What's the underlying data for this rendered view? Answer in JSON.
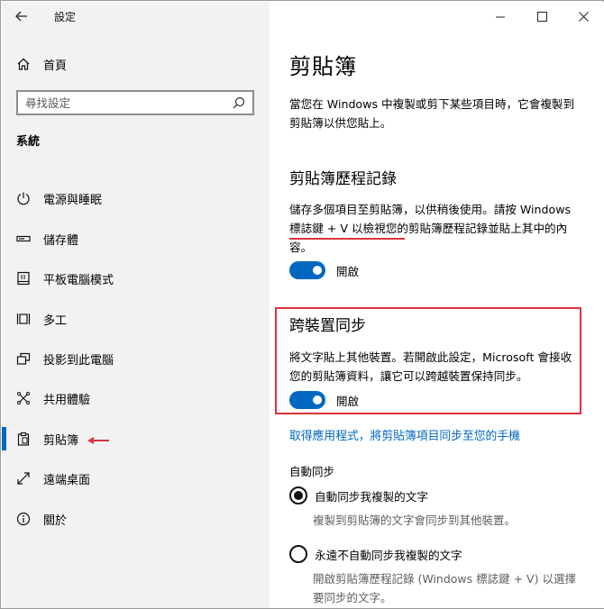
{
  "app": {
    "title": "設定"
  },
  "sidebar": {
    "home_label": "首頁",
    "search_placeholder": "尋找設定",
    "section": "系統",
    "items": [
      {
        "label": "電源與睡眠",
        "icon": "power-icon"
      },
      {
        "label": "儲存體",
        "icon": "storage-icon"
      },
      {
        "label": "平板電腦模式",
        "icon": "tablet-icon"
      },
      {
        "label": "多工",
        "icon": "multitasking-icon"
      },
      {
        "label": "投影到此電腦",
        "icon": "projecting-icon"
      },
      {
        "label": "共用體驗",
        "icon": "shared-experiences-icon"
      },
      {
        "label": "剪貼簿",
        "icon": "clipboard-icon",
        "active": true
      },
      {
        "label": "遠端桌面",
        "icon": "remote-desktop-icon"
      },
      {
        "label": "關於",
        "icon": "info-icon"
      }
    ]
  },
  "main": {
    "title": "剪貼簿",
    "intro": "當您在 Windows 中複製或剪下某些項目時，它會複製到剪貼簿以供您貼上。",
    "history": {
      "heading": "剪貼簿歷程記錄",
      "desc": "儲存多個項目至剪貼簿，以供稍後使用。請按 Windows 標誌鍵 + V 以檢視您的剪貼簿歷程記錄並貼上其中的內容。",
      "toggle_label": "開啟"
    },
    "sync": {
      "heading": "跨裝置同步",
      "desc": "將文字貼上其他裝置。若開啟此設定，Microsoft 會接收您的剪貼簿資料，讓它可以跨越裝置保持同步。",
      "toggle_label": "開啟"
    },
    "link": "取得應用程式，將剪貼簿項目同步至您的手機",
    "auto_sync_label": "自動同步",
    "options": [
      {
        "label": "自動同步我複製的文字",
        "desc": "複製到剪貼簿的文字會同步到其他裝置。",
        "selected": true
      },
      {
        "label": "永遠不自動同步我複製的文字",
        "desc": "開啟剪貼簿歷程記錄 (Windows 標誌鍵 + V) 以選擇要同步的文字。",
        "selected": false
      }
    ]
  },
  "colors": {
    "accent": "#0067c0",
    "annotation": "#d9343c",
    "sidebar_bg": "#f2f2f2"
  }
}
